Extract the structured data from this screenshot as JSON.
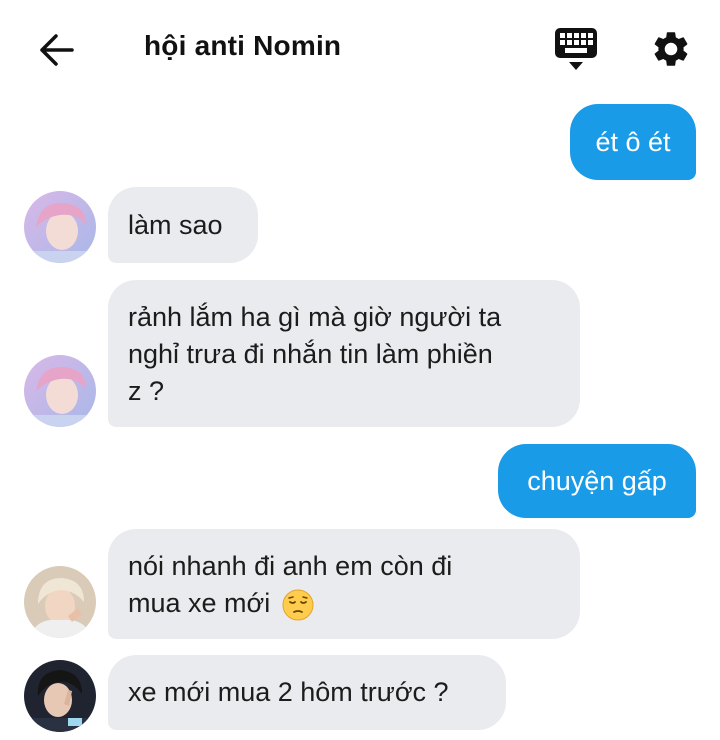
{
  "header": {
    "title": "hội anti Nomin",
    "back_icon": "arrow-left-icon",
    "keyboard_icon": "keyboard-icon",
    "settings_icon": "gear-icon"
  },
  "colors": {
    "outgoing_bubble": "#1a9be8",
    "incoming_bubble": "#e9ebee",
    "outgoing_text": "#ffffff",
    "incoming_text": "#1c1c1c"
  },
  "messages": [
    {
      "direction": "outgoing",
      "text": "ét ô ét"
    },
    {
      "direction": "incoming",
      "avatar": "avatar-pink-hair",
      "text": "làm sao"
    },
    {
      "direction": "incoming",
      "avatar": "avatar-pink-hair",
      "lines": [
        "rảnh lắm ha gì mà giờ người ta",
        "nghỉ trưa đi nhắn tin làm phiền",
        "z ?"
      ]
    },
    {
      "direction": "outgoing",
      "text": "chuyện gấp"
    },
    {
      "direction": "incoming",
      "avatar": "avatar-blond-hair",
      "lines": [
        "nói nhanh đi anh em còn đi",
        "mua xe mới"
      ],
      "emoji": "pensive-face-emoji"
    },
    {
      "direction": "incoming",
      "avatar": "avatar-dark-hair",
      "text": "xe mới mua 2 hôm trước ?"
    }
  ]
}
